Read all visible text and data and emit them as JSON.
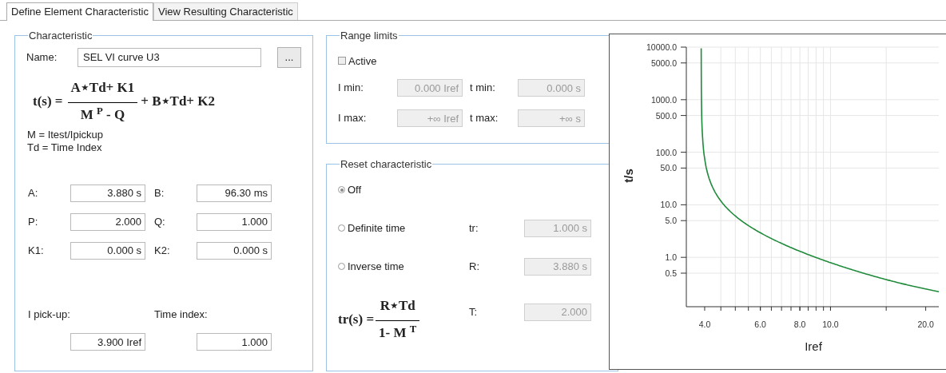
{
  "tabs": [
    {
      "label": "Define Element Characteristic",
      "selected": true
    },
    {
      "label": "View Resulting Characteristic",
      "selected": false
    }
  ],
  "characteristic": {
    "title": "Characteristic",
    "name_label": "Name:",
    "name_value": "SEL VI curve U3",
    "browse_button": "...",
    "formula": {
      "lhs": "t(s) =",
      "numerator": "A⋆Td+ K1",
      "denominator": "M $^{P}$ - Q",
      "tail": "+ B⋆Td+ K2"
    },
    "notes": [
      "M = Itest/Ipickup",
      "Td = Time Index"
    ],
    "params": [
      {
        "label": "A:",
        "value": "3.880 s"
      },
      {
        "label": "B:",
        "value": "96.30 ms"
      },
      {
        "label": "P:",
        "value": "2.000"
      },
      {
        "label": "Q:",
        "value": "1.000"
      },
      {
        "label": "K1:",
        "value": "0.000 s"
      },
      {
        "label": "K2:",
        "value": "0.000 s"
      }
    ],
    "pickup": {
      "label": "I pick-up:",
      "value": "3.900 Iref"
    },
    "time_index": {
      "label": "Time index:",
      "value": "1.000"
    }
  },
  "range_limits": {
    "title": "Range limits",
    "active": {
      "label": "Active",
      "checked": false
    },
    "fields": [
      {
        "label": "I min:",
        "value": "0.000 Iref",
        "disabled": true
      },
      {
        "label": "t min:",
        "value": "0.000 s",
        "disabled": true
      },
      {
        "label": "I max:",
        "value": "+∞ Iref",
        "disabled": true
      },
      {
        "label": "t max:",
        "value": "+∞ s",
        "disabled": true
      }
    ]
  },
  "reset": {
    "title": "Reset characteristic",
    "options": [
      {
        "label": "Off",
        "selected": true
      },
      {
        "label": "Definite time",
        "selected": false,
        "field": {
          "label": "tr:",
          "value": "1.000 s",
          "disabled": true
        }
      },
      {
        "label": "Inverse time",
        "selected": false,
        "field": {
          "label": "R:",
          "value": "3.880 s",
          "disabled": true
        }
      }
    ],
    "formula": {
      "lhs": "tr(s) =",
      "numerator": "R⋆Td",
      "denominator": "1- M $^{T}$"
    },
    "t_field": {
      "label": "T:",
      "value": "2.000",
      "disabled": true
    }
  },
  "chart": {
    "xlabel": "Iref",
    "ylabel": "t/s",
    "x_tick_labels": [
      "4.0",
      "6.0",
      "8.0",
      "10.0",
      "20.0"
    ],
    "y_tick_labels": [
      "10000.0",
      "5000.0",
      "1000.0",
      "500.0",
      "100.0",
      "50.0",
      "10.0",
      "5.0",
      "1.0",
      "0.5"
    ]
  }
}
